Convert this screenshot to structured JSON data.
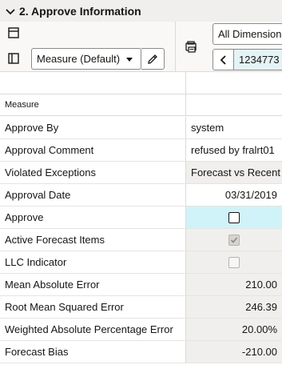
{
  "section": {
    "title": "2. Approve Information",
    "expanded_icon": "chevron-down-icon"
  },
  "toolbar": {
    "layout_icon": "panel-layout-icon",
    "sidebar_icon": "sidebar-toggle-icon",
    "measure_select": "Measure (Default)",
    "edit_icon": "pencil-icon",
    "print_icon": "print-layout-icon",
    "dimensions_select": "All Dimensions",
    "nav_prev_icon": "chevron-left-icon",
    "nav_label": "1234773 -"
  },
  "grid": {
    "row_header_title": "Measure",
    "rows": [
      {
        "label": "Approve By",
        "value": "system",
        "align": "left",
        "style": "editable"
      },
      {
        "label": "Approval Comment",
        "value": "refused by fralrt01",
        "align": "left",
        "style": "editable"
      },
      {
        "label": "Violated Exceptions",
        "value": "Forecast vs Recent",
        "align": "left",
        "style": "readonly"
      },
      {
        "label": "Approval Date",
        "value": "03/31/2019",
        "align": "right",
        "style": "editable"
      },
      {
        "label": "Approve",
        "value": "",
        "align": "center",
        "style": "highlight",
        "checkbox": "unchecked"
      },
      {
        "label": "Active Forecast Items",
        "value": "",
        "align": "center",
        "style": "readonly",
        "checkbox": "checked-disabled"
      },
      {
        "label": "LLC Indicator",
        "value": "",
        "align": "center",
        "style": "readonly",
        "checkbox": "disabled"
      },
      {
        "label": "Mean Absolute Error",
        "value": "210.00",
        "align": "right",
        "style": "readonly"
      },
      {
        "label": "Root Mean Squared Error",
        "value": "246.39",
        "align": "right",
        "style": "readonly"
      },
      {
        "label": "Weighted Absolute Percentage Error",
        "value": "20.00%",
        "align": "right",
        "style": "readonly"
      },
      {
        "label": "Forecast Bias",
        "value": "-210.00",
        "align": "right",
        "style": "readonly"
      }
    ]
  },
  "colors": {
    "header_bg": "#f1efed",
    "highlight_cell": "#cff3f8",
    "readonly_cell": "#f1efed",
    "border": "#dcdad7"
  }
}
